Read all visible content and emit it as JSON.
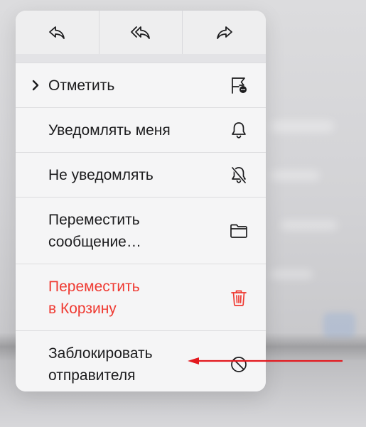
{
  "colors": {
    "destructive": "#ef3a32",
    "annotation_arrow": "#e3191f"
  },
  "actions": [
    {
      "icon": "reply-icon"
    },
    {
      "icon": "reply-all-icon"
    },
    {
      "icon": "forward-icon"
    }
  ],
  "menu": {
    "flag": {
      "label": "Отметить",
      "icon": "flag-icon"
    },
    "notify_me": {
      "label": "Уведомлять меня",
      "icon": "bell-icon"
    },
    "mute": {
      "label": "Не уведомлять",
      "icon": "bell-slash-icon"
    },
    "move_line1": "Переместить",
    "move_line2": "сообщение…",
    "trash_line1": "Переместить",
    "trash_line2": "в Корзину",
    "block_line1": "Заблокировать",
    "block_line2": "отправителя"
  }
}
